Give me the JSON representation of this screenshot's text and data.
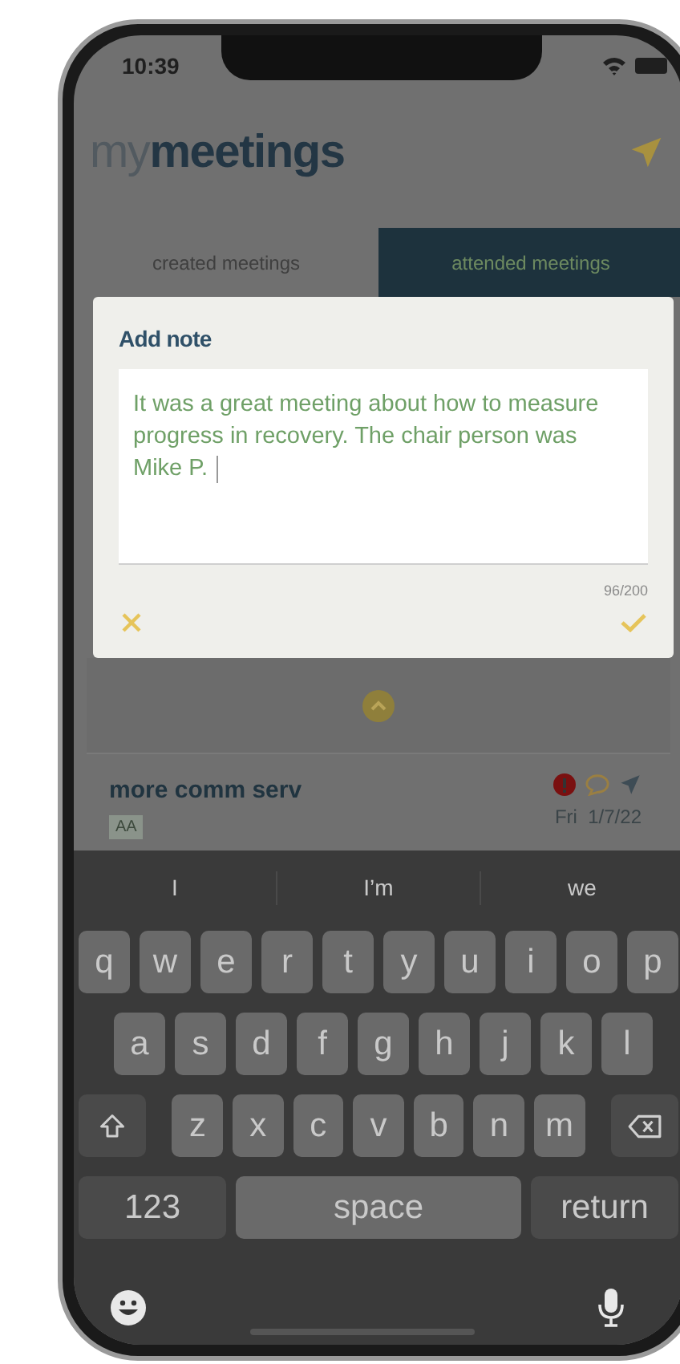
{
  "status_bar": {
    "time": "10:39"
  },
  "header": {
    "title_light": "my",
    "title_bold": "meetings"
  },
  "tabs": [
    {
      "label": "created meetings",
      "selected": false
    },
    {
      "label": "attended meetings",
      "selected": true
    }
  ],
  "dialog": {
    "title": "Add note",
    "value": "It was a great meeting about how to measure progress in recovery. The chair person was Mike P.",
    "counter": "96/200"
  },
  "meeting": {
    "title": "more comm serv",
    "tag": "AA",
    "date": "Fri  1/7/22",
    "alert": true
  },
  "keyboard": {
    "suggestions": [
      "I",
      "I’m",
      "we"
    ],
    "rows": [
      {
        "keys": [
          {
            "kind": "letter",
            "label": "q"
          },
          {
            "kind": "letter",
            "label": "w"
          },
          {
            "kind": "letter",
            "label": "e"
          },
          {
            "kind": "letter",
            "label": "r"
          },
          {
            "kind": "letter",
            "label": "t"
          },
          {
            "kind": "letter",
            "label": "y"
          },
          {
            "kind": "letter",
            "label": "u"
          },
          {
            "kind": "letter",
            "label": "i"
          },
          {
            "kind": "letter",
            "label": "o"
          },
          {
            "kind": "letter",
            "label": "p"
          }
        ]
      },
      {
        "keys": [
          {
            "kind": "letter",
            "label": "a"
          },
          {
            "kind": "letter",
            "label": "s"
          },
          {
            "kind": "letter",
            "label": "d"
          },
          {
            "kind": "letter",
            "label": "f"
          },
          {
            "kind": "letter",
            "label": "g"
          },
          {
            "kind": "letter",
            "label": "h"
          },
          {
            "kind": "letter",
            "label": "j"
          },
          {
            "kind": "letter",
            "label": "k"
          },
          {
            "kind": "letter",
            "label": "l"
          }
        ]
      },
      {
        "keys": [
          {
            "kind": "shift"
          },
          {
            "kind": "letter",
            "label": "z"
          },
          {
            "kind": "letter",
            "label": "x"
          },
          {
            "kind": "letter",
            "label": "c"
          },
          {
            "kind": "letter",
            "label": "v"
          },
          {
            "kind": "letter",
            "label": "b"
          },
          {
            "kind": "letter",
            "label": "n"
          },
          {
            "kind": "letter",
            "label": "m"
          },
          {
            "kind": "backspace"
          }
        ]
      },
      {
        "keys": [
          {
            "kind": "numbers",
            "label": "123"
          },
          {
            "kind": "space",
            "label": "space"
          },
          {
            "kind": "return",
            "label": "return"
          }
        ]
      }
    ]
  }
}
